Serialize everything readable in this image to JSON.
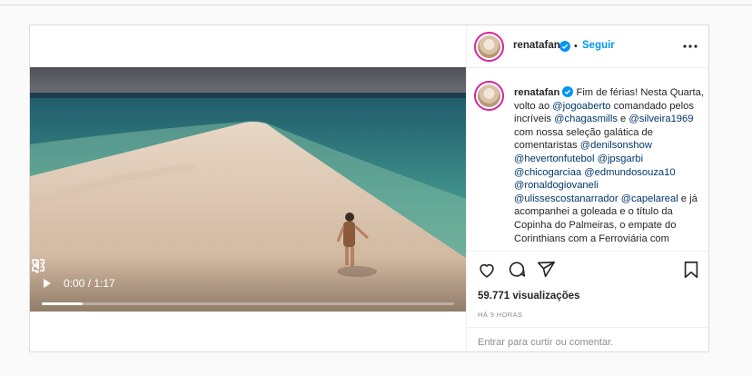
{
  "colors": {
    "accent": "#0095f6",
    "text": "#262626",
    "muted": "#8e8e8e",
    "mention": "#00376b",
    "border": "#dbdbdb"
  },
  "post": {
    "author": "renatafan",
    "follow_label": "Seguir",
    "dot": "•",
    "more_icon": "more-horizontal-icon"
  },
  "video": {
    "time": "0:00 / 1:17",
    "progress": 0.1
  },
  "caption": {
    "username": "renatafan",
    "segments": [
      {
        "t": " Fim de férias! Nesta Quarta, volto ao ",
        "m": false
      },
      {
        "t": "@jogoaberto",
        "m": true
      },
      {
        "t": " comandado pelos incríveis ",
        "m": false
      },
      {
        "t": "@chagasmills",
        "m": true
      },
      {
        "t": " e ",
        "m": false
      },
      {
        "t": "@silveira1969",
        "m": true
      },
      {
        "t": " com nossa seleção galática de comentaristas ",
        "m": false
      },
      {
        "t": "@denilsonshow",
        "m": true
      },
      {
        "t": " ",
        "m": false
      },
      {
        "t": "@hevertonfutebol",
        "m": true
      },
      {
        "t": " ",
        "m": false
      },
      {
        "t": "@jpsgarbi",
        "m": true
      },
      {
        "t": " ",
        "m": false
      },
      {
        "t": "@chicogarciaa",
        "m": true
      },
      {
        "t": " ",
        "m": false
      },
      {
        "t": "@edmundosouza10",
        "m": true
      },
      {
        "t": " ",
        "m": false
      },
      {
        "t": "@ronaldogiovaneli",
        "m": true
      },
      {
        "t": " ",
        "m": false
      },
      {
        "t": "@ulissescostanarrador",
        "m": true
      },
      {
        "t": " ",
        "m": false
      },
      {
        "t": "@capelareal",
        "m": true
      },
      {
        "t": " e já acompanhei a goleada e o título da Copinha do Palmeiras, o empate do Corinthians com a Ferroviária com Camelinho...",
        "m": false
      }
    ]
  },
  "stats": {
    "views": "59.771 visualizações",
    "time_ago": "HÁ 9 HORAS"
  },
  "comment": {
    "login_label": "Entrar",
    "prompt": " para curtir ou comentar."
  }
}
